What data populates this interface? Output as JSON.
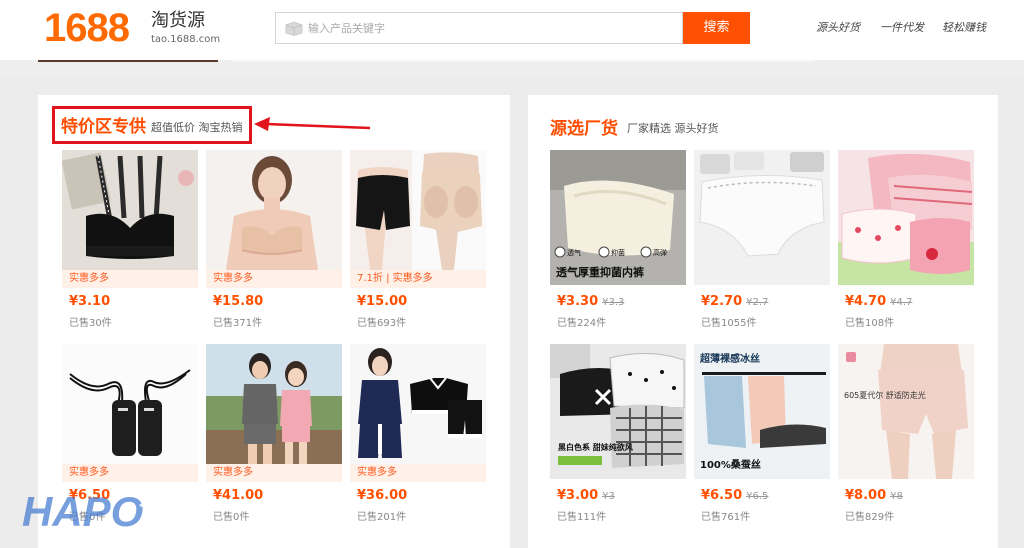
{
  "header": {
    "logo_number": "1688",
    "brand_name": "淘货源",
    "brand_url": "tao.1688.com",
    "search_placeholder": "输入产品关键字",
    "search_button": "搜索",
    "nav_links": [
      "源头好货",
      "一件代发",
      "轻松赚钱"
    ]
  },
  "left_section": {
    "title": "特价区专供",
    "subtitle": "超值低价 淘宝热销",
    "products": [
      {
        "tag": "实惠多多",
        "price": "¥3.10",
        "sold": "已售30件"
      },
      {
        "tag": "实惠多多",
        "price": "¥15.80",
        "sold": "已售371件"
      },
      {
        "tag": "7.1折 | 实惠多多",
        "price": "¥15.00",
        "sold": "已售693件"
      },
      {
        "tag": "实惠多多",
        "price": "¥6.50",
        "sold": "已售0件"
      },
      {
        "tag": "实惠多多",
        "price": "¥41.00",
        "sold": "已售0件"
      },
      {
        "tag": "实惠多多",
        "price": "¥36.00",
        "sold": "已售201件"
      }
    ]
  },
  "right_section": {
    "title": "源选厂货",
    "subtitle": "厂家精选 源头好货",
    "products": [
      {
        "price": "¥3.30",
        "old_price": "¥3.3",
        "sold": "已售224件",
        "img_text": "透气厚重抑菌内裤",
        "img_badges": [
          "透气",
          "抑菌",
          "高弹"
        ]
      },
      {
        "price": "¥2.70",
        "old_price": "¥2.7",
        "sold": "已售1055件"
      },
      {
        "price": "¥4.70",
        "old_price": "¥4.7",
        "sold": "已售108件"
      },
      {
        "price": "¥3.00",
        "old_price": "¥3",
        "sold": "已售111件",
        "img_text": "黑白色系 甜妹纯欲风"
      },
      {
        "price": "¥6.50",
        "old_price": "¥6.5",
        "sold": "已售761件",
        "img_text": "超薄裸感冰丝",
        "img_text2": "100%桑蚕丝"
      },
      {
        "price": "¥8.00",
        "old_price": "¥8",
        "sold": "已售829件",
        "img_text": "605夏代尔 舒适防走光"
      }
    ]
  },
  "watermark": "HAPO",
  "colors": {
    "brand_orange": "#ff6a00",
    "search_button": "#ff4f00",
    "price": "#ff5000",
    "tag_bg": "#fff0e8",
    "highlight_red": "#e1131b"
  }
}
